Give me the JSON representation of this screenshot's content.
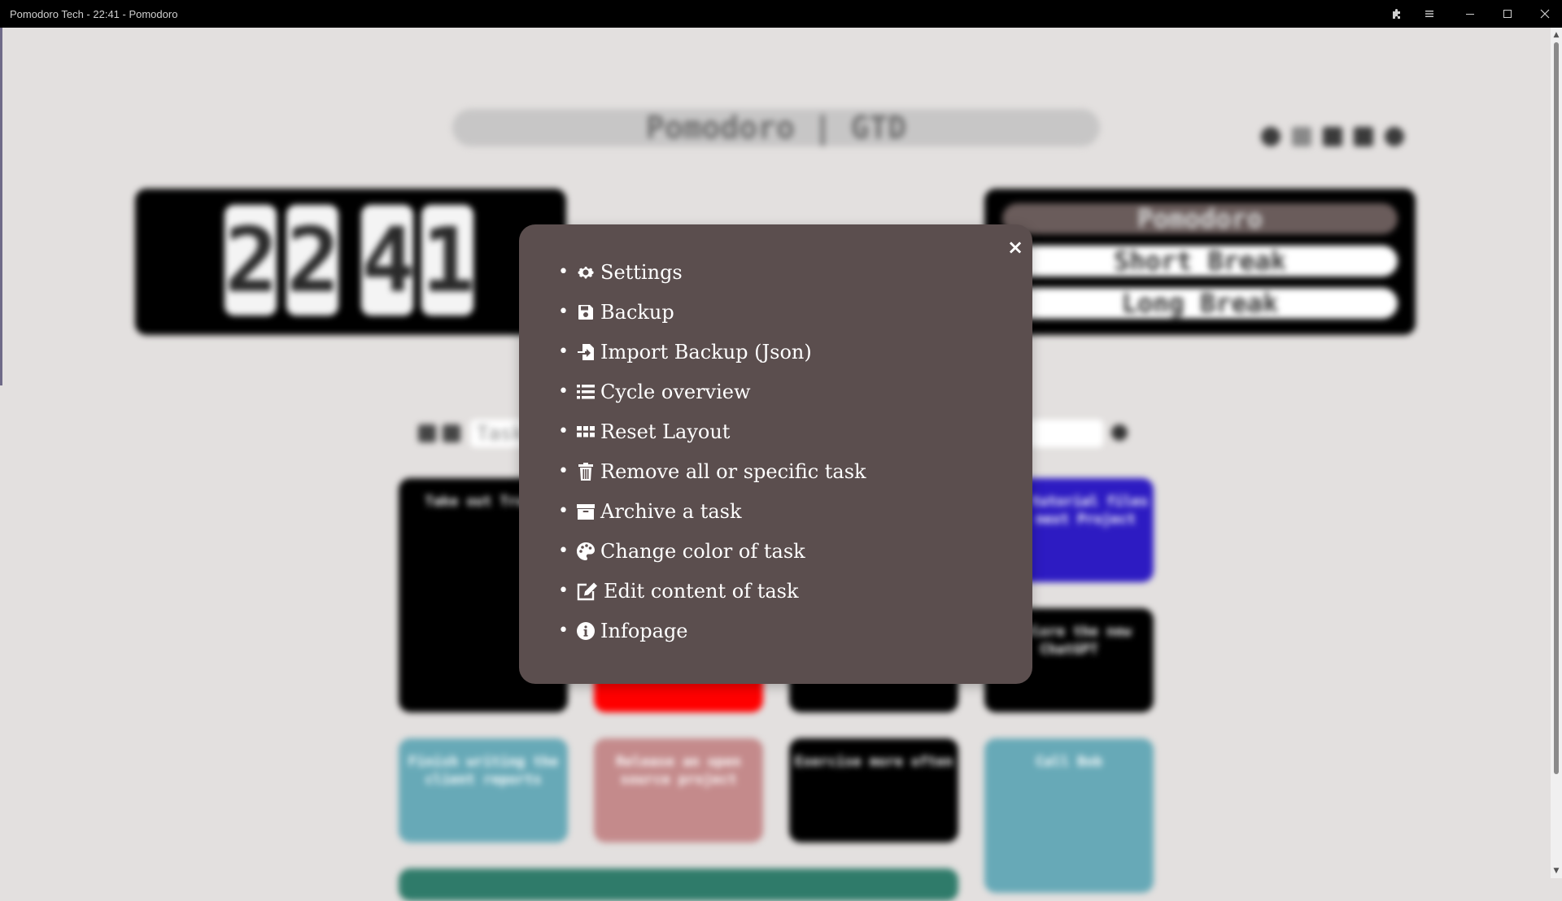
{
  "window": {
    "title": "Pomodoro Tech - 22:41 - Pomodoro"
  },
  "app": {
    "header_title": "Pomodoro | GTD",
    "clock": {
      "h1": "2",
      "h2": "2",
      "m1": "4",
      "m2": "1"
    },
    "modes": [
      {
        "label": "Pomodoro",
        "active": true
      },
      {
        "label": "Short Break",
        "active": false
      },
      {
        "label": "Long Break",
        "active": false
      }
    ],
    "task_input_placeholder": "Task",
    "tasks": [
      {
        "text": "Take out Trash",
        "color": "#000000"
      },
      {
        "text": "",
        "color": "#ff0000"
      },
      {
        "text": "",
        "color": "#000000"
      },
      {
        "text": "Make tutorial files for next Project",
        "color": "#2d1bc2"
      },
      {
        "text": "Explore the new ChatGPT",
        "color": "#000000"
      },
      {
        "text": "Finish writing the client reports",
        "color": "#67a9b7"
      },
      {
        "text": "Release an open source project",
        "color": "#c48a8b"
      },
      {
        "text": "Exercise more often",
        "color": "#000000"
      },
      {
        "text": "Call Bob",
        "color": "#67a9b7"
      },
      {
        "text": "",
        "color": "#2f7b6a"
      }
    ]
  },
  "menu": {
    "close_label": "×",
    "items": [
      {
        "label": "Settings",
        "icon": "gear-icon"
      },
      {
        "label": "Backup",
        "icon": "save-icon"
      },
      {
        "label": "Import Backup (Json)",
        "icon": "file-import-icon"
      },
      {
        "label": "Cycle overview",
        "icon": "list-icon"
      },
      {
        "label": "Reset Layout",
        "icon": "grid-icon"
      },
      {
        "label": "Remove all or specific task",
        "icon": "trash-icon"
      },
      {
        "label": "Archive a task",
        "icon": "archive-icon"
      },
      {
        "label": "Change color of task",
        "icon": "palette-icon"
      },
      {
        "label": "Edit content of task",
        "icon": "edit-icon"
      },
      {
        "label": "Infopage",
        "icon": "info-icon"
      }
    ]
  },
  "colors": {
    "modal_bg": "#5b4e4e",
    "page_bg": "#e3e0df",
    "active_mode": "#6a5c5b"
  }
}
